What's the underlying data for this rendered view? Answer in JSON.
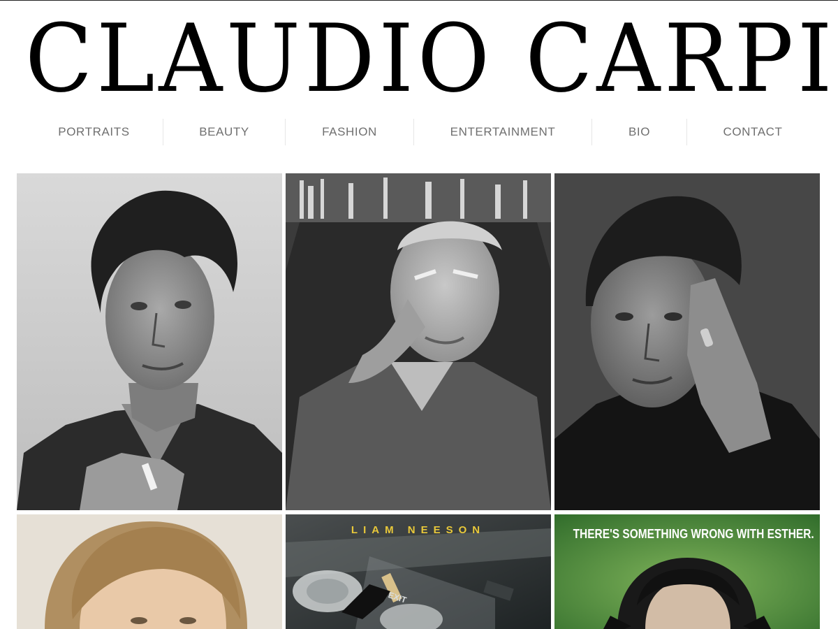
{
  "site": {
    "title": "CLAUDIO CARPI"
  },
  "nav": {
    "items": [
      {
        "label": "PORTRAITS"
      },
      {
        "label": "BEAUTY"
      },
      {
        "label": "FASHION"
      },
      {
        "label": "ENTERTAINMENT"
      },
      {
        "label": "BIO"
      },
      {
        "label": "CONTACT"
      }
    ]
  },
  "gallery": {
    "tiles": [
      {
        "kind": "portrait-photo"
      },
      {
        "kind": "portrait-photo"
      },
      {
        "kind": "portrait-photo"
      },
      {
        "kind": "beauty-photo"
      },
      {
        "kind": "movie-poster",
        "poster_title": "LIAM NEESON",
        "sign_text": "EXIT"
      },
      {
        "kind": "movie-poster",
        "tagline": "THERE'S SOMETHING WRONG WITH ESTHER."
      }
    ]
  }
}
